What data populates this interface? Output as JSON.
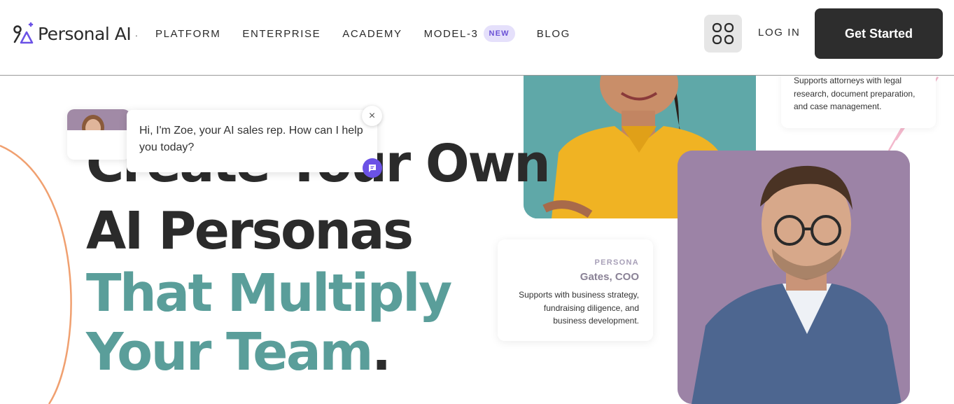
{
  "header": {
    "brand": "Personal AI",
    "brand_mark": ".",
    "nav": [
      {
        "label": "PLATFORM"
      },
      {
        "label": "ENTERPRISE"
      },
      {
        "label": "ACADEMY"
      },
      {
        "label": "MODEL-3",
        "badge": "NEW"
      },
      {
        "label": "BLOG"
      }
    ],
    "apps_icon": "grid-apps-icon",
    "login_label": "LOG IN",
    "cta_label": "Get Started"
  },
  "hero": {
    "line1": "Create Your Own",
    "line2": "AI Personas",
    "line3": "That Multiply",
    "line4": "Your Team",
    "period": "."
  },
  "chat": {
    "message": "Hi, I'm Zoe, your AI sales rep. How can I help you today?",
    "close_label": "×",
    "icon": "chat-bubble-icon"
  },
  "cards": {
    "top": {
      "desc": "Supports attorneys with legal research, document preparation, and case management."
    },
    "gates": {
      "kicker": "PERSONA",
      "name": "Gates, COO",
      "desc": "Supports with business strategy, fundraising diligence, and business development."
    }
  },
  "colors": {
    "accent_teal": "#5a9e9a",
    "dark": "#2d2d2d",
    "badge_bg": "#e5e0fb",
    "badge_text": "#6b52d6",
    "chat_accent": "#6b52e6",
    "orange_curve": "#f0a070",
    "pink_line": "#f3b8cc"
  }
}
